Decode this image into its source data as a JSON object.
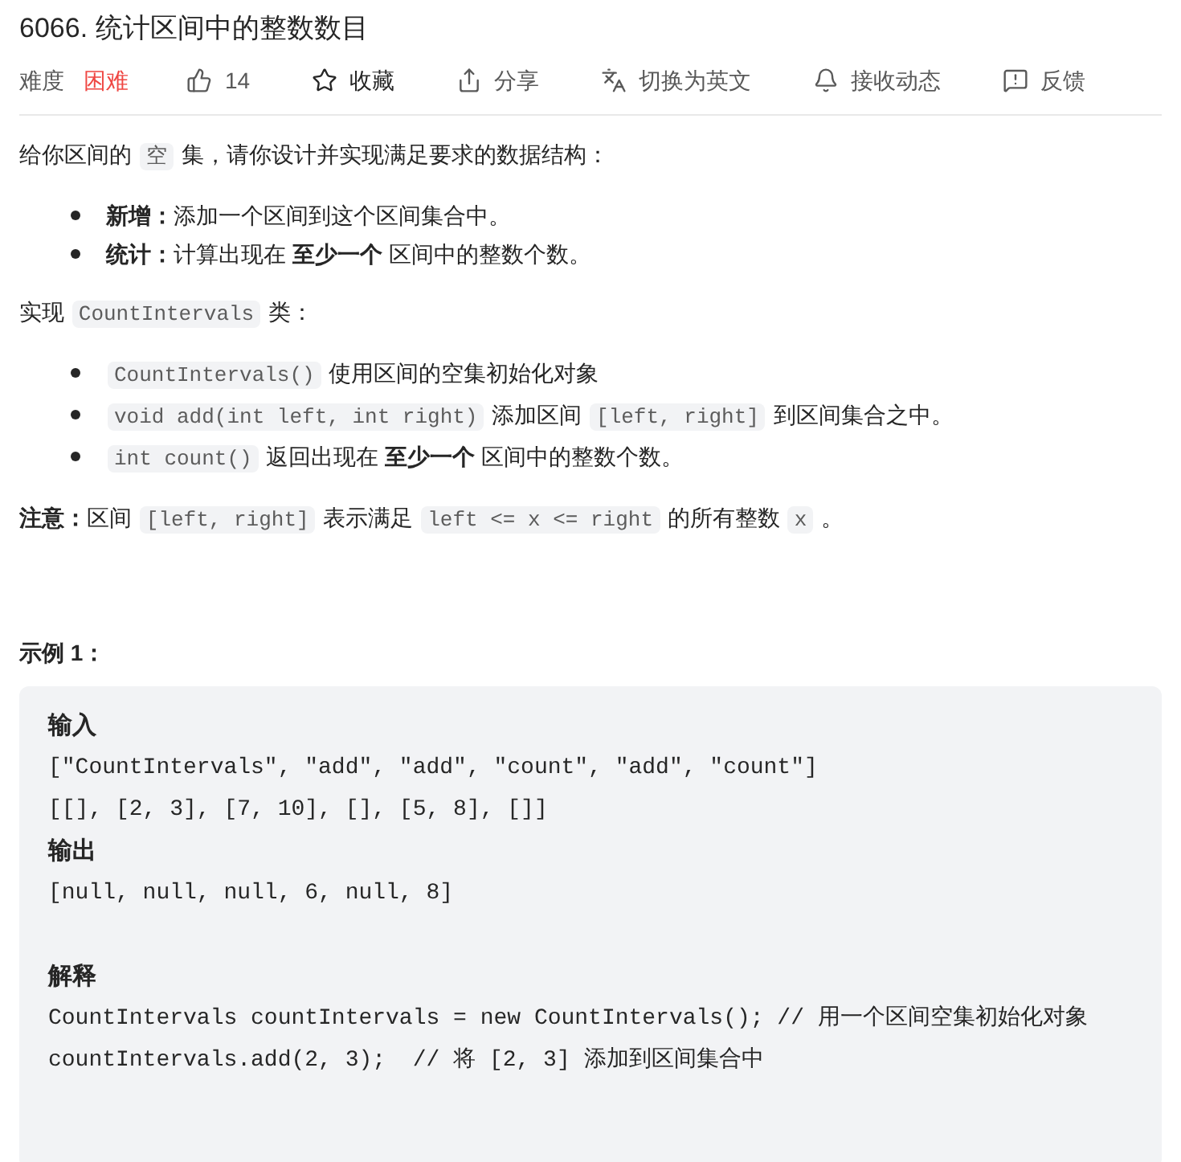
{
  "title": "6066. 统计区间中的整数数目",
  "meta": {
    "difficulty_label": "难度",
    "difficulty": "困难",
    "actions": [
      {
        "kind": "like",
        "label": "14"
      },
      {
        "kind": "star",
        "label": "收藏"
      },
      {
        "kind": "share",
        "label": "分享"
      },
      {
        "kind": "translate",
        "label": "切换为英文"
      },
      {
        "kind": "bell",
        "label": "接收动态"
      },
      {
        "kind": "feedback",
        "label": "反馈"
      }
    ]
  },
  "description": [
    {
      "kind": "para",
      "segments": [
        {
          "kind": "text",
          "text": "给你区间的 "
        },
        {
          "kind": "code",
          "text": "空"
        },
        {
          "kind": "text",
          "text": " 集，请你设计并实现满足要求的数据结构："
        }
      ]
    },
    {
      "kind": "list",
      "items": [
        [
          {
            "kind": "text",
            "text": "**新增：**添加一个区间到这个区间集合中。"
          }
        ],
        [
          {
            "kind": "text",
            "text": "**统计：**计算出现在 **至少一个** 区间中的整数个数。"
          }
        ]
      ]
    },
    {
      "kind": "para",
      "segments": [
        {
          "kind": "text",
          "text": "实现 "
        },
        {
          "kind": "code",
          "text": "CountIntervals"
        },
        {
          "kind": "text",
          "text": " 类："
        }
      ]
    },
    {
      "kind": "list",
      "items": [
        [
          {
            "kind": "code",
            "text": "CountIntervals()"
          },
          {
            "kind": "text",
            "text": " 使用区间的空集初始化对象"
          }
        ],
        [
          {
            "kind": "code",
            "text": "void add(int left, int right)"
          },
          {
            "kind": "text",
            "text": " 添加区间 "
          },
          {
            "kind": "code",
            "text": "[left, right]"
          },
          {
            "kind": "text",
            "text": " 到区间集合之中。"
          }
        ],
        [
          {
            "kind": "code",
            "text": "int count()"
          },
          {
            "kind": "text",
            "text": " 返回出现在 **至少一个** 区间中的整数个数。"
          }
        ]
      ]
    },
    {
      "kind": "para",
      "segments": [
        {
          "kind": "text",
          "text": "**注意：**区间 "
        },
        {
          "kind": "code",
          "text": "[left, right]"
        },
        {
          "kind": "text",
          "text": " 表示满足 "
        },
        {
          "kind": "code",
          "text": "left <= x <= right"
        },
        {
          "kind": "text",
          "text": " 的所有整数 "
        },
        {
          "kind": "code",
          "text": "x"
        },
        {
          "kind": "text",
          "text": " 。"
        }
      ]
    }
  ],
  "example": {
    "title": "示例 1：",
    "lines": [
      {
        "kind": "heading",
        "text": "输入"
      },
      {
        "kind": "code",
        "text": "[\"CountIntervals\", \"add\", \"add\", \"count\", \"add\", \"count\"]"
      },
      {
        "kind": "code",
        "text": "[[], [2, 3], [7, 10], [], [5, 8], []]"
      },
      {
        "kind": "heading",
        "text": "输出"
      },
      {
        "kind": "code",
        "text": "[null, null, null, 6, null, 8]"
      },
      {
        "kind": "blank"
      },
      {
        "kind": "heading",
        "text": "解释"
      },
      {
        "kind": "code",
        "text": "CountIntervals countIntervals = new CountIntervals(); // 用一个区间空集初始化对象"
      },
      {
        "kind": "code",
        "text": "countIntervals.add(2, 3);  // 将 [2, 3] 添加到区间集合中"
      }
    ]
  }
}
